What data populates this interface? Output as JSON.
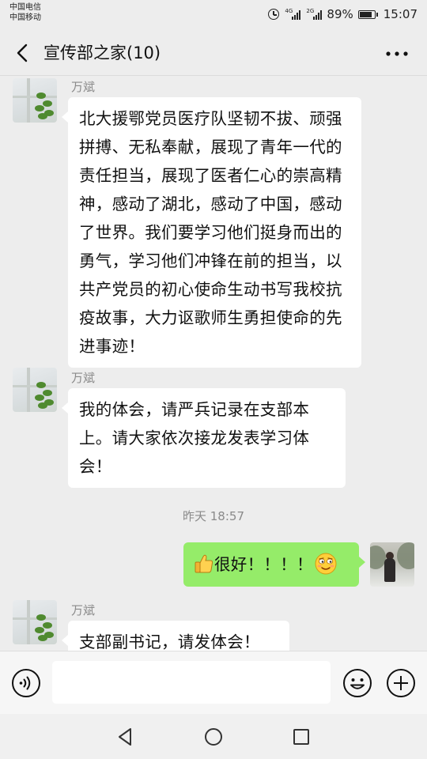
{
  "status_bar": {
    "carrier1": "中国电信",
    "carrier2": "中国移动",
    "signal1_tag": "4G",
    "signal2_tag": "2G",
    "battery": "89%",
    "time": "15:07"
  },
  "header": {
    "title": "宣传部之家(10)"
  },
  "messages": [
    {
      "sender": "万斌",
      "text": "北大援鄂党员医疗队坚韧不拔、顽强拼搏、无私奉献，展现了青年一代的责任担当，展现了医者仁心的崇高精神，感动了湖北，感动了中国，感动了世界。我们要学习他们挺身而出的勇气，学习他们冲锋在前的担当，以共产党员的初心使命生动书写我校抗疫故事，大力讴歌师生勇担使命的先进事迹！"
    },
    {
      "sender": "万斌",
      "text": "我的体会，请严兵记录在支部本上。请大家依次接龙发表学习体会！"
    },
    {
      "timestamp": "昨天 18:57"
    },
    {
      "self": true,
      "text": "很好！！！！"
    },
    {
      "sender": "万斌",
      "text": "支部副书记，请发体会！"
    }
  ],
  "input": {
    "value": ""
  },
  "colors": {
    "background": "#ededed",
    "self_bubble": "#95ec69",
    "other_bubble": "#ffffff",
    "meta_text": "#8a8a8a"
  },
  "icons": {
    "back": "chevron-left-icon",
    "more": "more-dots-icon",
    "voice": "voice-icon",
    "emoji": "emoji-icon",
    "plus": "plus-icon",
    "thumbs_up": "thumbs-up-emoji",
    "smirk": "smirk-emoji"
  }
}
